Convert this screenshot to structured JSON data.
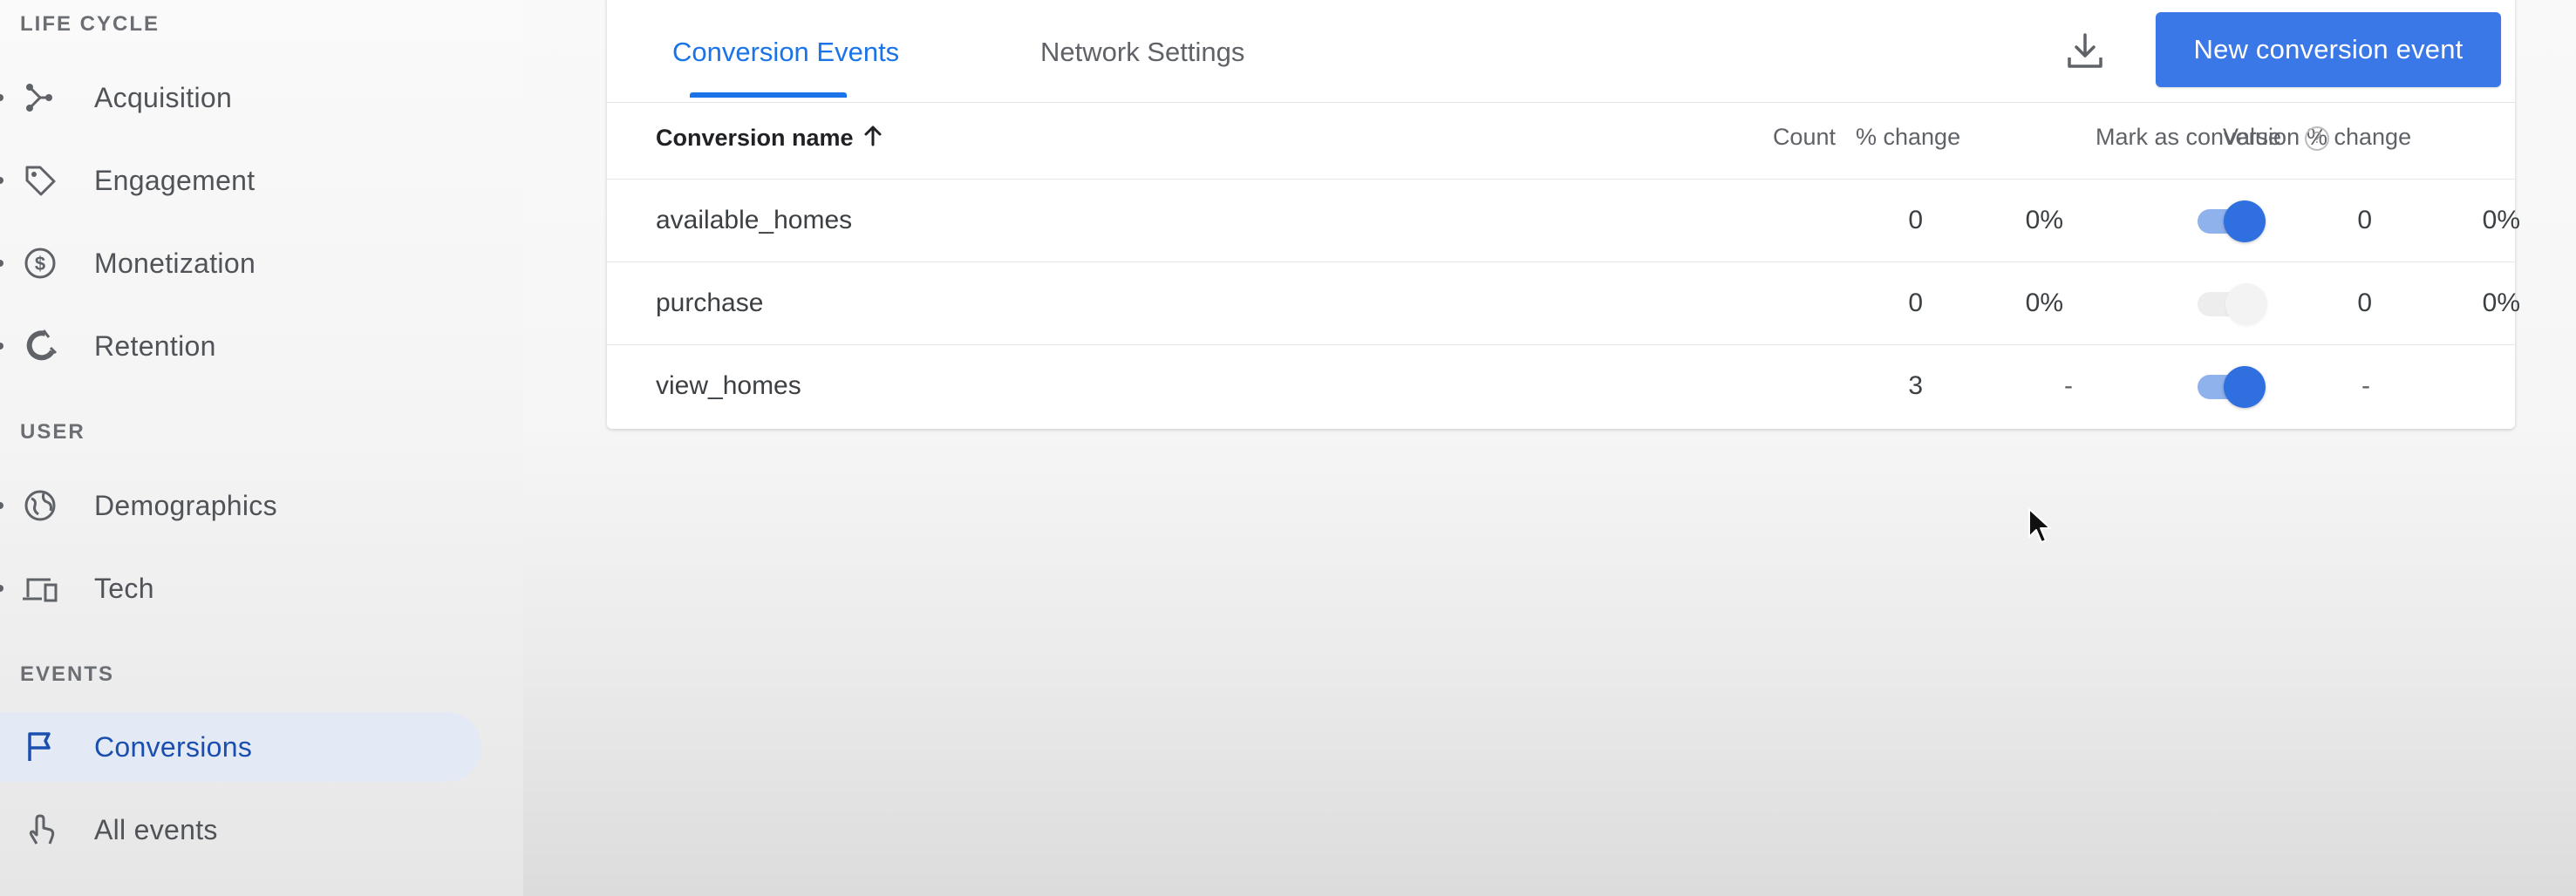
{
  "sidebar": {
    "sections": [
      {
        "header": "LIFE CYCLE",
        "items": [
          {
            "label": "Acquisition",
            "icon": "acquisition-icon"
          },
          {
            "label": "Engagement",
            "icon": "tag-icon"
          },
          {
            "label": "Monetization",
            "icon": "dollar-icon"
          },
          {
            "label": "Retention",
            "icon": "magnet-icon"
          }
        ]
      },
      {
        "header": "USER",
        "items": [
          {
            "label": "Demographics",
            "icon": "globe-icon"
          },
          {
            "label": "Tech",
            "icon": "devices-icon"
          }
        ]
      },
      {
        "header": "EVENTS",
        "items": [
          {
            "label": "Conversions",
            "icon": "flag-icon",
            "active": true
          },
          {
            "label": "All events",
            "icon": "touch-icon"
          }
        ]
      }
    ]
  },
  "tabs": [
    {
      "label": "Conversion Events",
      "active": true
    },
    {
      "label": "Network Settings",
      "active": false
    }
  ],
  "toolbar": {
    "download_icon": "download-icon",
    "new_button_label": "New conversion event"
  },
  "table": {
    "columns": {
      "name": "Conversion name",
      "count": "Count",
      "count_change": "% change",
      "value": "Value",
      "value_change": "% change",
      "mark": "Mark as conversion",
      "help": "?"
    },
    "rows": [
      {
        "name": "available_homes",
        "count": "0",
        "count_change": "0%",
        "value": "0",
        "value_change": "0%",
        "mark_as_conversion": true
      },
      {
        "name": "purchase",
        "count": "0",
        "count_change": "0%",
        "value": "0",
        "value_change": "0%",
        "mark_as_conversion": false
      },
      {
        "name": "view_homes",
        "count": "3",
        "count_change": "-",
        "value": "-",
        "value_change": "",
        "mark_as_conversion": true
      }
    ]
  },
  "colors": {
    "accent": "#1a73e8",
    "button": "#3b78e7",
    "toggle_on": "#2f6fe0",
    "active_nav_bg": "#e3eaf5"
  }
}
